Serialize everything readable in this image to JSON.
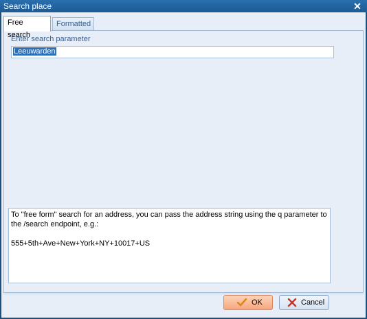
{
  "window": {
    "title": "Search place"
  },
  "tabs": [
    {
      "label": "Free search",
      "active": true
    },
    {
      "label": "Formatted",
      "active": false
    }
  ],
  "form": {
    "param_label": "Enter search parameter",
    "param_value": "Leeuwarden"
  },
  "info": {
    "text": "To \"free form\" search for an address, you can pass the address string using the q parameter to the /search endpoint, e.g.:\n\n555+5th+Ave+New+York+NY+10017+US"
  },
  "buttons": {
    "ok_label": "OK",
    "cancel_label": "Cancel"
  },
  "icons": {
    "close": "close-icon",
    "ok": "checkmark-icon",
    "cancel": "x-icon"
  },
  "colors": {
    "title_bar": "#1c5a93",
    "client_bg": "#e7eef7",
    "selection": "#2f6fb8",
    "ok_button": "#f7a77e",
    "checkmark": "#e0861a",
    "cancel_x": "#c0392b"
  }
}
